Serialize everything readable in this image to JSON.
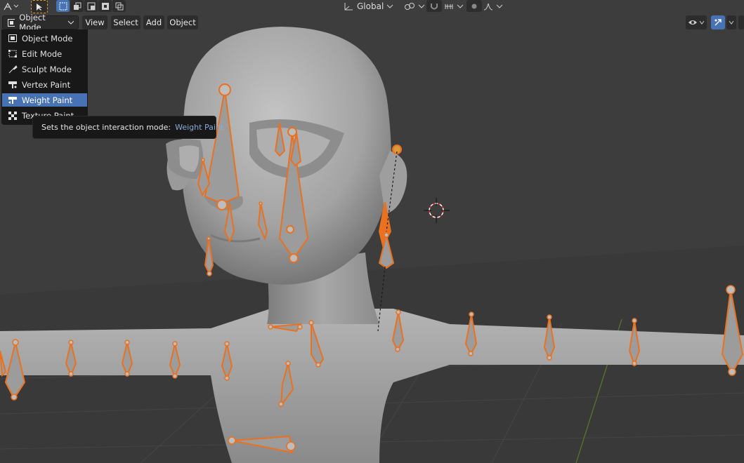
{
  "header": {
    "mode_label": "Object Mode",
    "menus": [
      "View",
      "Select",
      "Add",
      "Object"
    ]
  },
  "toolbar": {
    "transform_orientation": "Global"
  },
  "mode_menu": {
    "items": [
      {
        "label": "Object Mode",
        "icon": "object-mode-icon"
      },
      {
        "label": "Edit Mode",
        "icon": "edit-mode-icon"
      },
      {
        "label": "Sculpt Mode",
        "icon": "sculpt-mode-icon"
      },
      {
        "label": "Vertex Paint",
        "icon": "vertex-paint-icon"
      },
      {
        "label": "Weight Paint",
        "icon": "weight-paint-icon"
      },
      {
        "label": "Texture Paint",
        "icon": "texture-paint-icon"
      }
    ],
    "selected": "Weight Paint"
  },
  "tooltip": {
    "text": "Sets the object interaction mode:",
    "value": "Weight Paint"
  },
  "colors": {
    "viewport_bg": "#3d3d3d",
    "mesh": "#a9a9a9",
    "bone_outline": "#e9711f",
    "selection_blue": "#4772b3"
  }
}
